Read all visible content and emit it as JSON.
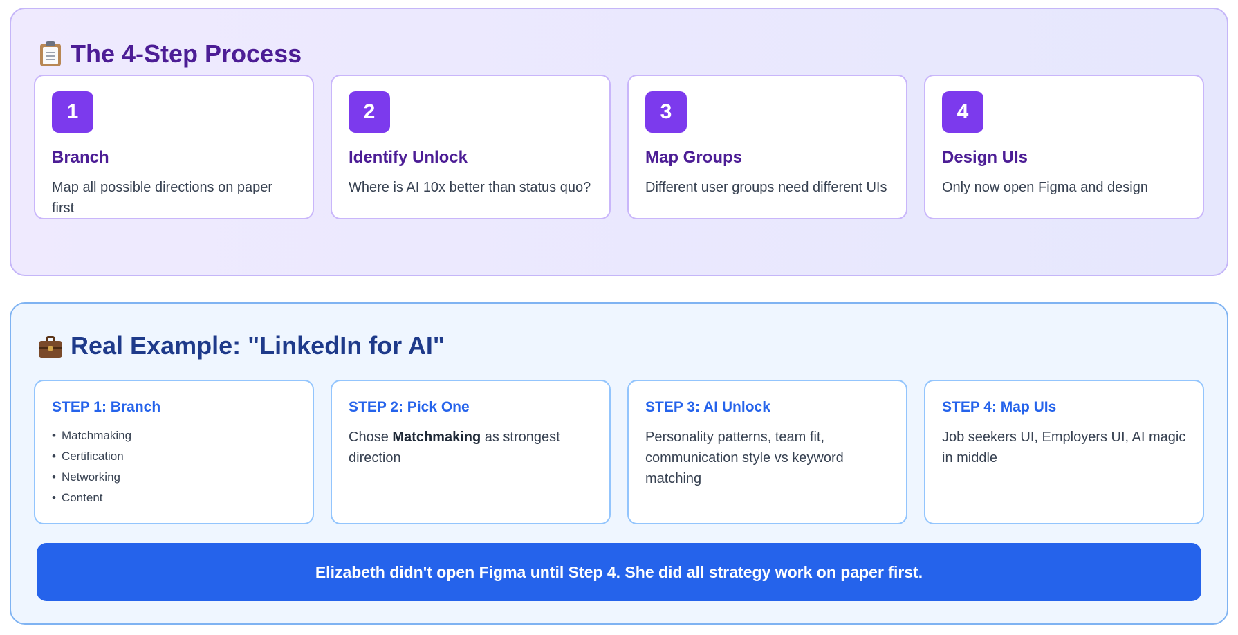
{
  "process": {
    "title": "The 4-Step Process",
    "icon": "clipboard-icon",
    "steps": [
      {
        "number": "1",
        "title": "Branch",
        "desc": "Map all possible directions on paper first"
      },
      {
        "number": "2",
        "title": "Identify Unlock",
        "desc": "Where is AI 10x better than status quo?"
      },
      {
        "number": "3",
        "title": "Map Groups",
        "desc": "Different user groups need different UIs"
      },
      {
        "number": "4",
        "title": "Design UIs",
        "desc": "Only now open Figma and design"
      }
    ]
  },
  "example": {
    "title": "Real Example: \"LinkedIn for AI\"",
    "icon": "briefcase-icon",
    "steps": [
      {
        "title": "STEP 1: Branch",
        "items": [
          "Matchmaking",
          "Certification",
          "Networking",
          "Content"
        ]
      },
      {
        "title": "STEP 2: Pick One",
        "desc_prefix": "Chose ",
        "desc_bold": "Matchmaking",
        "desc_suffix": " as strongest direction"
      },
      {
        "title": "STEP 3: AI Unlock",
        "desc": "Personality patterns, team fit, communication style vs keyword matching"
      },
      {
        "title": "STEP 4: Map UIs",
        "desc": "Job seekers UI, Employers UI, AI magic in middle"
      }
    ],
    "banner": "Elizabeth didn't open Figma until Step 4. She did all strategy work on paper first."
  },
  "colors": {
    "accent_purple": "#7c3aed",
    "title_purple": "#4c1d95",
    "accent_blue": "#2563eb",
    "title_blue": "#1e3a8a"
  }
}
